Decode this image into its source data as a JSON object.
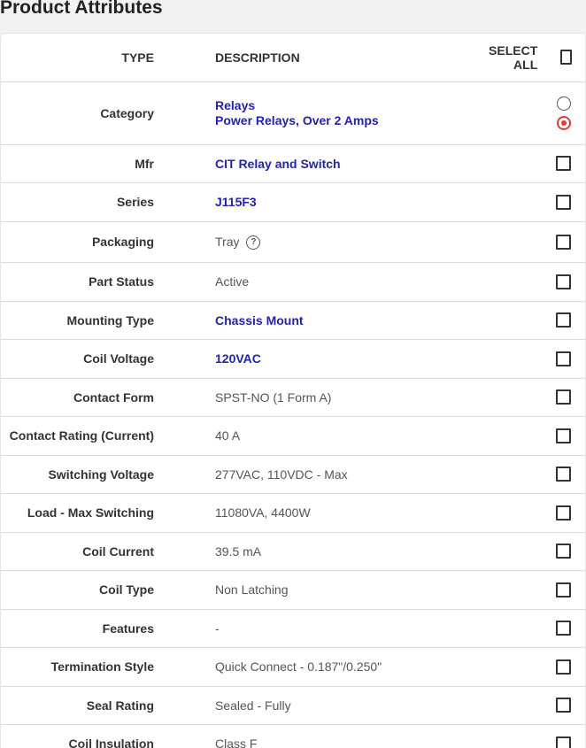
{
  "title": "Product Attributes",
  "header": {
    "type": "TYPE",
    "description": "DESCRIPTION",
    "select_all": "SELECT ALL"
  },
  "category": {
    "label": "Category",
    "values": [
      "Relays",
      "Power Relays, Over 2 Amps"
    ],
    "selected_index": 1
  },
  "rows": [
    {
      "label": "Mfr",
      "value": "CIT Relay and Switch",
      "link": true,
      "height": 43
    },
    {
      "label": "Series",
      "value": "J115F3",
      "link": true,
      "height": 44
    },
    {
      "label": "Packaging",
      "value": "Tray",
      "link": false,
      "help": true,
      "height": 46
    },
    {
      "label": "Part Status",
      "value": "Active",
      "link": false,
      "height": 44
    },
    {
      "label": "Mounting Type",
      "value": "Chassis Mount",
      "link": true,
      "height": 43
    },
    {
      "label": "Coil Voltage",
      "value": "120VAC",
      "link": true,
      "height": 44
    },
    {
      "label": "Contact Form",
      "value": "SPST-NO (1 Form A)",
      "link": false,
      "height": 43
    },
    {
      "label": "Contact Rating (Current)",
      "value": "40 A",
      "link": false,
      "height": 44
    },
    {
      "label": "Switching Voltage",
      "value": "277VAC, 110VDC - Max",
      "link": false,
      "height": 43
    },
    {
      "label": "Load - Max Switching",
      "value": "11080VA, 4400W",
      "link": false,
      "height": 44
    },
    {
      "label": "Coil Current",
      "value": "39.5 mA",
      "link": false,
      "height": 43
    },
    {
      "label": "Coil Type",
      "value": "Non Latching",
      "link": false,
      "height": 44
    },
    {
      "label": "Features",
      "value": "-",
      "link": false,
      "height": 43
    },
    {
      "label": "Termination Style",
      "value": "Quick Connect - 0.187\"/0.250\"",
      "link": false,
      "height": 44
    },
    {
      "label": "Seal Rating",
      "value": "Sealed - Fully",
      "link": false,
      "height": 43
    },
    {
      "label": "Coil Insulation",
      "value": "Class F",
      "link": false,
      "height": 44
    }
  ],
  "colors": {
    "link": "#2222b8",
    "radio_selected": "#e53935",
    "border": "#dcdcdc"
  },
  "icons": {
    "help": "question-circle-icon",
    "checkbox": "checkbox-unchecked-icon"
  }
}
